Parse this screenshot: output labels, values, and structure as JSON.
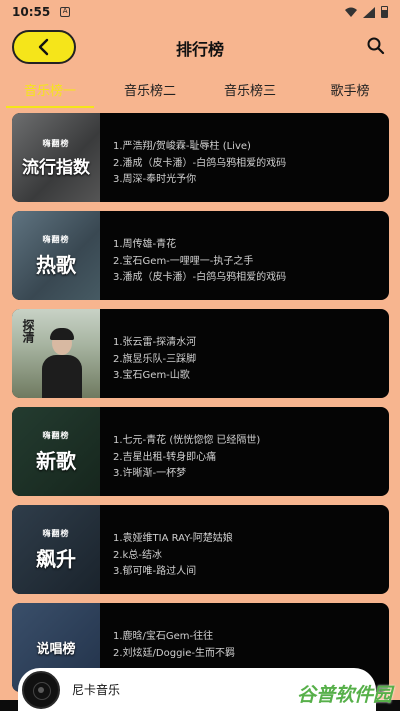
{
  "status_bar": {
    "time": "10:55",
    "notif": "A"
  },
  "header": {
    "title": "排行榜"
  },
  "tabs": [
    {
      "label": "音乐榜一",
      "active": true
    },
    {
      "label": "音乐榜二",
      "active": false
    },
    {
      "label": "音乐榜三",
      "active": false
    },
    {
      "label": "歌手榜",
      "active": false
    }
  ],
  "charts": [
    {
      "brand": "嗨翻榜",
      "name": "流行指数",
      "songs": [
        "1.严浩翔/贺峻霖-耻辱柱 (Live)",
        "2.潘成（皮卡潘）-白鸽乌鸦相爱的戏码",
        "3.周深-奉时光予你"
      ]
    },
    {
      "brand": "嗨翻榜",
      "name": "热歌",
      "songs": [
        "1.周传雄-青花",
        "2.宝石Gem-一哩哩一-执子之手",
        "3.潘成（皮卡潘）-白鸽乌鸦相爱的戏码"
      ]
    },
    {
      "brand": "",
      "name": "",
      "calli": "探清",
      "songs": [
        "1.张云雷-探清水河",
        "2.旗昱乐队-三踩脚",
        "3.宝石Gem-山歌"
      ]
    },
    {
      "brand": "嗨翻榜",
      "name": "新歌",
      "songs": [
        "1.七元-青花 (恍恍惚惚 已经隔世)",
        "2.吉星出租-转身即心痛",
        "3.许晰渐-一杯梦"
      ]
    },
    {
      "brand": "嗨翻榜",
      "name": "飙升",
      "songs": [
        "1.袁娅维TIA RAY-阿楚姑娘",
        "2.k总-结冰",
        "3.郁可唯-路过人间"
      ]
    },
    {
      "brand": "",
      "name": "说唱榜",
      "songs": [
        "1.鹿晗/宝石Gem-往往",
        "2.刘炫廷/Doggie-生而不羁",
        ""
      ]
    }
  ],
  "player": {
    "title": "尼卡音乐"
  },
  "watermark": "谷普软件园",
  "colors": {
    "background": "#f7b58f",
    "accent": "#f5e51a",
    "card": "#050505"
  }
}
